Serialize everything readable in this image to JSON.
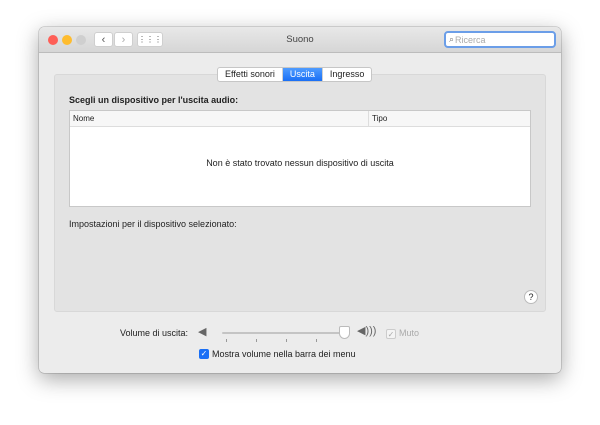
{
  "window": {
    "title": "Suono",
    "search_placeholder": "Ricerca"
  },
  "tabs": [
    {
      "label": "Effetti sonori"
    },
    {
      "label": "Uscita",
      "active": true
    },
    {
      "label": "Ingresso"
    }
  ],
  "output": {
    "heading": "Scegli un dispositivo per l'uscita audio:",
    "columns": [
      "Nome",
      "Tipo"
    ],
    "empty_message": "Non è stato trovato nessun dispositivo di uscita",
    "settings_label": "Impostazioni per il dispositivo selezionato:"
  },
  "volume": {
    "label": "Volume di uscita:",
    "level": 1.0,
    "mute_label": "Muto",
    "mute_checked": true,
    "mute_enabled": false
  },
  "menubar_option": {
    "label": "Mostra volume nella barra dei menu",
    "checked": true
  },
  "help": "?",
  "colors": {
    "accent": "#1a6ff5",
    "close": "#fe5f57",
    "minimize": "#febc2e"
  }
}
